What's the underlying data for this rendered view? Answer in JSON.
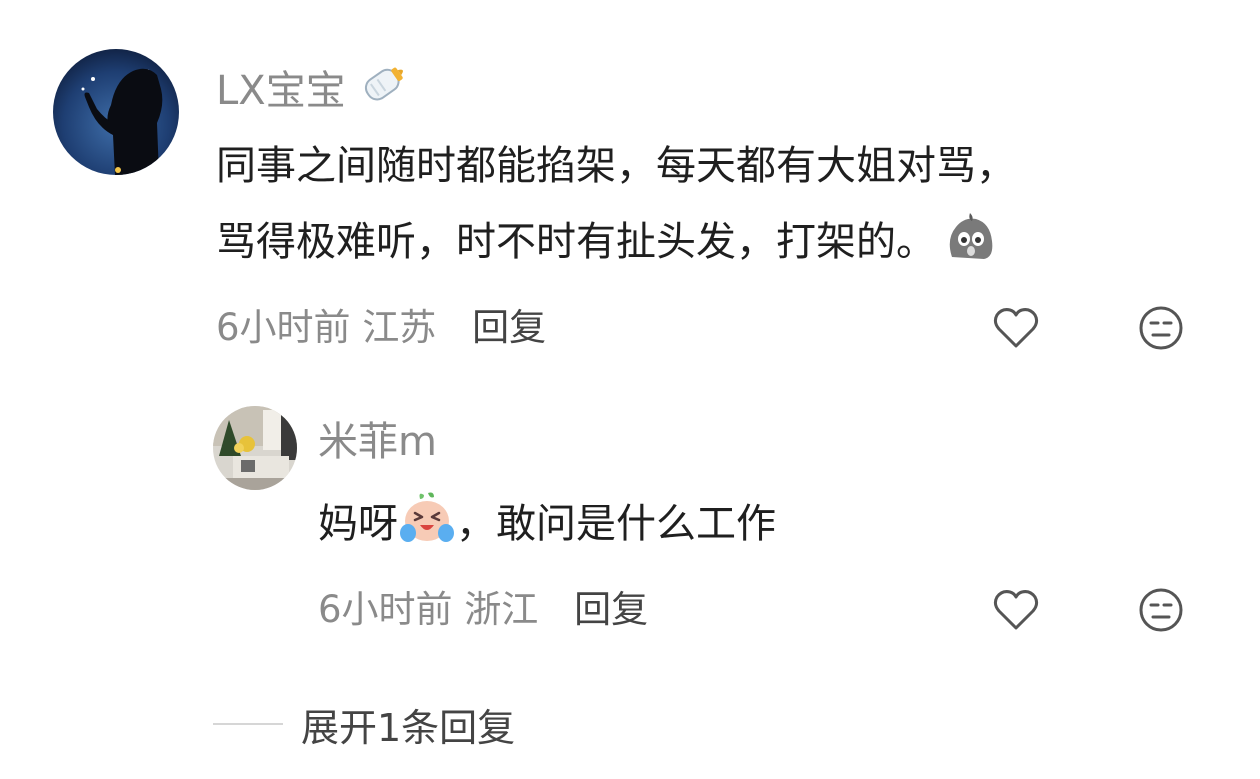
{
  "comments": [
    {
      "username": "LX宝宝",
      "username_emoji": "baby-bottle-icon",
      "text_lines": [
        "同事之间随时都能掐架，每天都有大姐对骂，",
        "骂得极难听，时不时有扯头发，打架的。"
      ],
      "text_emoji": "shocked-face-icon",
      "time": "6小时前",
      "location": "江苏",
      "reply_label": "回复",
      "reply": {
        "username": "米菲m",
        "text_before": "妈呀",
        "text_emoji": "laughing-crying-face-icon",
        "text_after": "，敢问是什么工作",
        "time": "6小时前",
        "location": "浙江",
        "reply_label": "回复"
      }
    }
  ],
  "expand": {
    "label": "展开1条回复"
  },
  "colors": {
    "secondary_text": "#8a8a8a",
    "primary_text": "#1f1f1f",
    "icon_stroke": "#555555"
  }
}
